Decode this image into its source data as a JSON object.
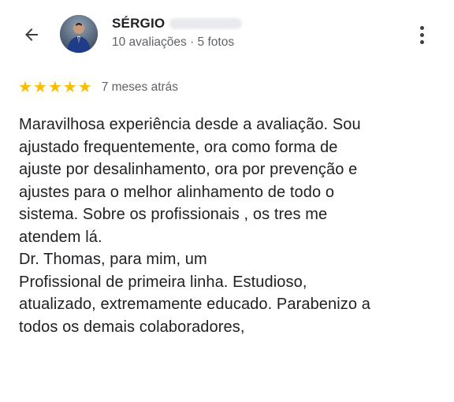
{
  "reviewer": {
    "name": "SÉRGIO",
    "meta": "10 avaliações · 5 fotos"
  },
  "review": {
    "rating": 5,
    "rating_max": 5,
    "time": "7 meses atrás",
    "text": "Maravilhosa experiência desde a avaliação. Sou\najustado frequentemente, ora como forma de\najuste por desalinhamento, ora por prevenção e\najustes para o melhor alinhamento de todo o\nsistema. Sobre os profissionais , os tres me\natendem lá.\nDr. Thomas, para mim, um\nProfissional de primeira linha. Estudioso,\natualizado, extremamente educado. Parabenizo a\ntodos os demais colaboradores,"
  },
  "icons": {
    "back": "arrow-back-icon",
    "more": "more-vert-icon",
    "star": "star-icon"
  },
  "colors": {
    "star": "#fbbc04",
    "meta_text": "#5f6368",
    "body_text": "#202124"
  }
}
